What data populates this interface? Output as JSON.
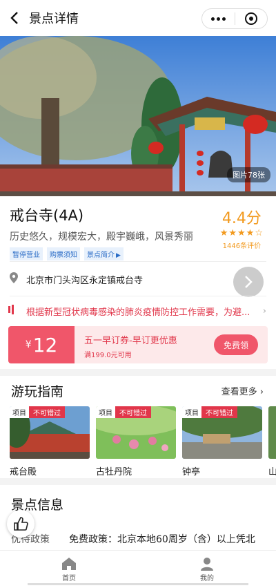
{
  "header": {
    "title": "景点详情"
  },
  "hero": {
    "photo_count": "图片78张"
  },
  "spot": {
    "name": "戒台寺(4A)",
    "desc": "历史悠久，规模宏大，殿宇巍峨，风景秀丽",
    "tags": [
      "暂停营业",
      "购票须知",
      "景点简介"
    ],
    "score": "4.4分",
    "stars": "★★★★☆",
    "reviews": "1446条评价"
  },
  "address": "北京市门头沟区永定镇戒台寺",
  "notice": "根据新型冠状病毒感染的肺炎疫情防控工作需要，为避...",
  "coupon": {
    "symbol": "¥",
    "amount": "12",
    "title": "五一早订券-早订更优惠",
    "condition": "满199.0元可用",
    "button": "免费领"
  },
  "guide": {
    "title": "游玩指南",
    "more": "查看更多",
    "cards": [
      {
        "tag1": "项目",
        "tag2": "不可错过",
        "name": "戒台殿"
      },
      {
        "tag1": "项目",
        "tag2": "不可错过",
        "name": "古牡丹院"
      },
      {
        "tag1": "项目",
        "tag2": "不可错过",
        "name": "钟亭"
      },
      {
        "tag1": "",
        "tag2": "",
        "name": "山"
      }
    ]
  },
  "scenic_info": {
    "title": "景点信息",
    "policy_label": "优待政策",
    "policy_value": "免费政策：北京本地60周岁（含）以上凭北"
  },
  "tabbar": {
    "home": "首页",
    "mine": "我的"
  }
}
